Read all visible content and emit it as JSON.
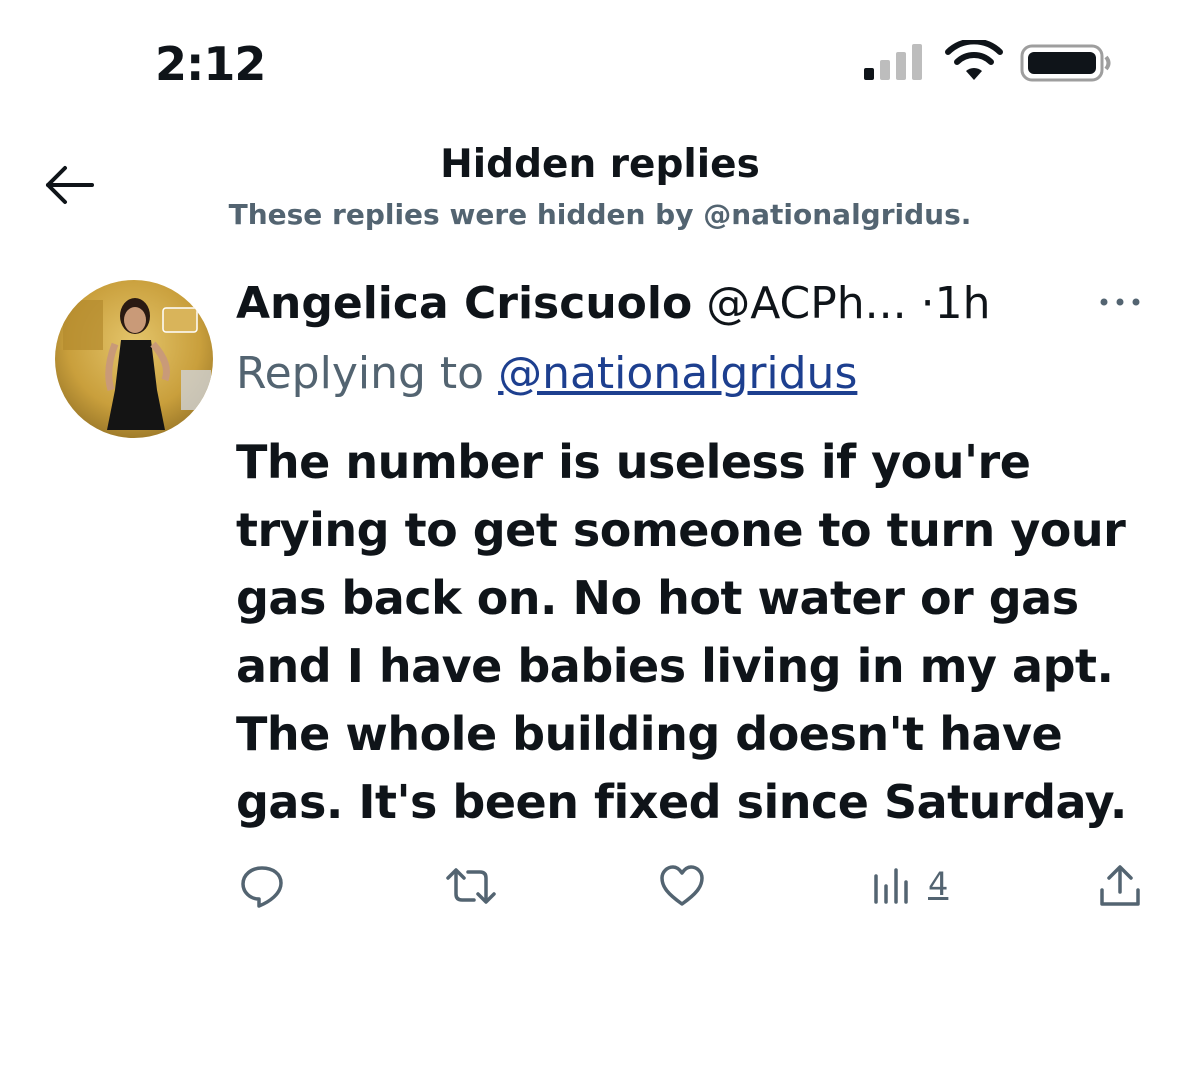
{
  "status_bar": {
    "time": "2:12",
    "signal_icon": "cellular-signal-icon",
    "wifi_icon": "wifi-icon",
    "battery_icon": "battery-icon"
  },
  "header": {
    "back_icon": "back-arrow-icon",
    "title": "Hidden replies",
    "subtitle": "These replies were hidden by @nationalgridus."
  },
  "tweet": {
    "author_name": "Angelica Criscuolo",
    "author_handle": "@ACPh...",
    "separator": "·",
    "time": "1h",
    "more_icon": "more-options-icon",
    "replying_prefix": "Replying to",
    "replying_to": "@nationalgridus",
    "body_lines": [
      "The number is useless if you're",
      "trying to get someone to turn your",
      "gas back on. No hot water or gas",
      "and I have babies living in my apt.",
      "The whole building doesn't have",
      "gas. It's been fixed since Saturday."
    ],
    "actions": {
      "reply_icon": "reply-icon",
      "retweet_icon": "retweet-icon",
      "like_icon": "heart-icon",
      "views_icon": "views-chart-icon",
      "views_count": "4",
      "share_icon": "share-icon"
    }
  },
  "colors": {
    "text_primary": "#0f1419",
    "text_secondary": "#536471",
    "link": "#1d3f8f",
    "background": "#ffffff"
  }
}
